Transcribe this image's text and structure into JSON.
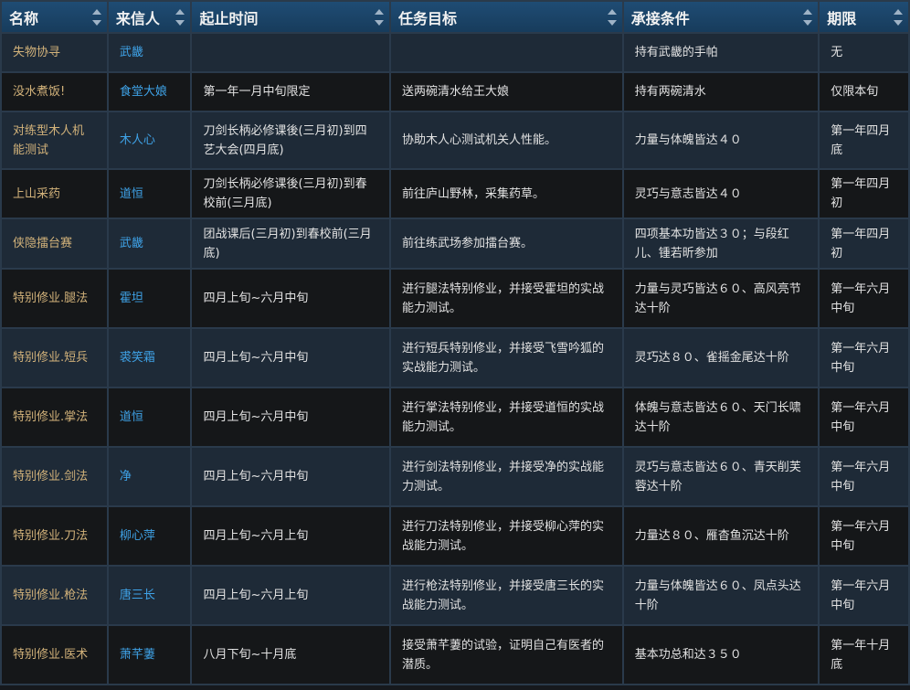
{
  "headers": [
    "名称",
    "来信人",
    "起止时间",
    "任务目标",
    "承接条件",
    "期限"
  ],
  "rows": [
    {
      "name": "失物协寻",
      "sender": "武畿",
      "period": "",
      "goal": "",
      "condition": "持有武畿的手帕",
      "deadline": "无"
    },
    {
      "name": "没水煮饭!",
      "sender": "食堂大娘",
      "period": "第一年一月中旬限定",
      "goal": "送两碗清水给王大娘",
      "condition": "持有两碗清水",
      "deadline": "仅限本旬"
    },
    {
      "name": "对练型木人机能测试",
      "sender": "木人心",
      "period": "刀剑长柄必修课後(三月初)到四艺大会(四月底)",
      "goal": "协助木人心测试机关人性能。",
      "condition": "力量与体魄皆达４０",
      "deadline": "第一年四月底"
    },
    {
      "name": "上山采药",
      "sender": "道恒",
      "period": "刀剑长柄必修课後(三月初)到春校前(三月底)",
      "goal": "前往庐山野林，采集药草。",
      "condition": "灵巧与意志皆达４０",
      "deadline": "第一年四月初"
    },
    {
      "name": "侠隐擂台赛",
      "sender": "武畿",
      "period": "团战课后(三月初)到春校前(三月底)",
      "goal": "前往练武场参加擂台赛。",
      "condition": "四项基本功皆达３０；与段红儿、锺若昕参加",
      "deadline": "第一年四月初"
    },
    {
      "name": "特别修业.腿法",
      "sender": "霍坦",
      "period": "四月上旬~六月中旬",
      "goal": "进行腿法特别修业，并接受霍坦的实战能力测试。",
      "condition": "力量与灵巧皆达６０、高风亮节达十阶",
      "deadline": "第一年六月中旬"
    },
    {
      "name": "特别修业.短兵",
      "sender": "裘笑霜",
      "period": "四月上旬~六月中旬",
      "goal": "进行短兵特别修业，并接受飞雪吟狐的实战能力测试。",
      "condition": "灵巧达８０、雀摇金尾达十阶",
      "deadline": "第一年六月中旬"
    },
    {
      "name": "特别修业.掌法",
      "sender": "道恒",
      "period": "四月上旬~六月中旬",
      "goal": "进行掌法特别修业，并接受道恒的实战能力测试。",
      "condition": "体魄与意志皆达６０、天门长啸达十阶",
      "deadline": "第一年六月中旬"
    },
    {
      "name": "特别修业.剑法",
      "sender": "净",
      "period": "四月上旬~六月中旬",
      "goal": "进行剑法特别修业，并接受净的实战能力测试。",
      "condition": "灵巧与意志皆达６０、青天削芙蓉达十阶",
      "deadline": "第一年六月中旬"
    },
    {
      "name": "特别修业.刀法",
      "sender": "柳心萍",
      "period": "四月上旬~六月上旬",
      "goal": "进行刀法特别修业，并接受柳心萍的实战能力测试。",
      "condition": "力量达８０、雁杳鱼沉达十阶",
      "deadline": "第一年六月中旬"
    },
    {
      "name": "特别修业.枪法",
      "sender": "唐三长",
      "period": "四月上旬~六月上旬",
      "goal": "进行枪法特别修业，并接受唐三长的实战能力测试。",
      "condition": "力量与体魄皆达６０、凤点头达十阶",
      "deadline": "第一年六月中旬"
    },
    {
      "name": "特别修业.医术",
      "sender": "萧芊萋",
      "period": "八月下旬~十月底",
      "goal": "接受萧芊萋的试验，证明自己有医者的潜质。",
      "condition": "基本功总和达３５０",
      "deadline": "第一年十月底"
    }
  ]
}
